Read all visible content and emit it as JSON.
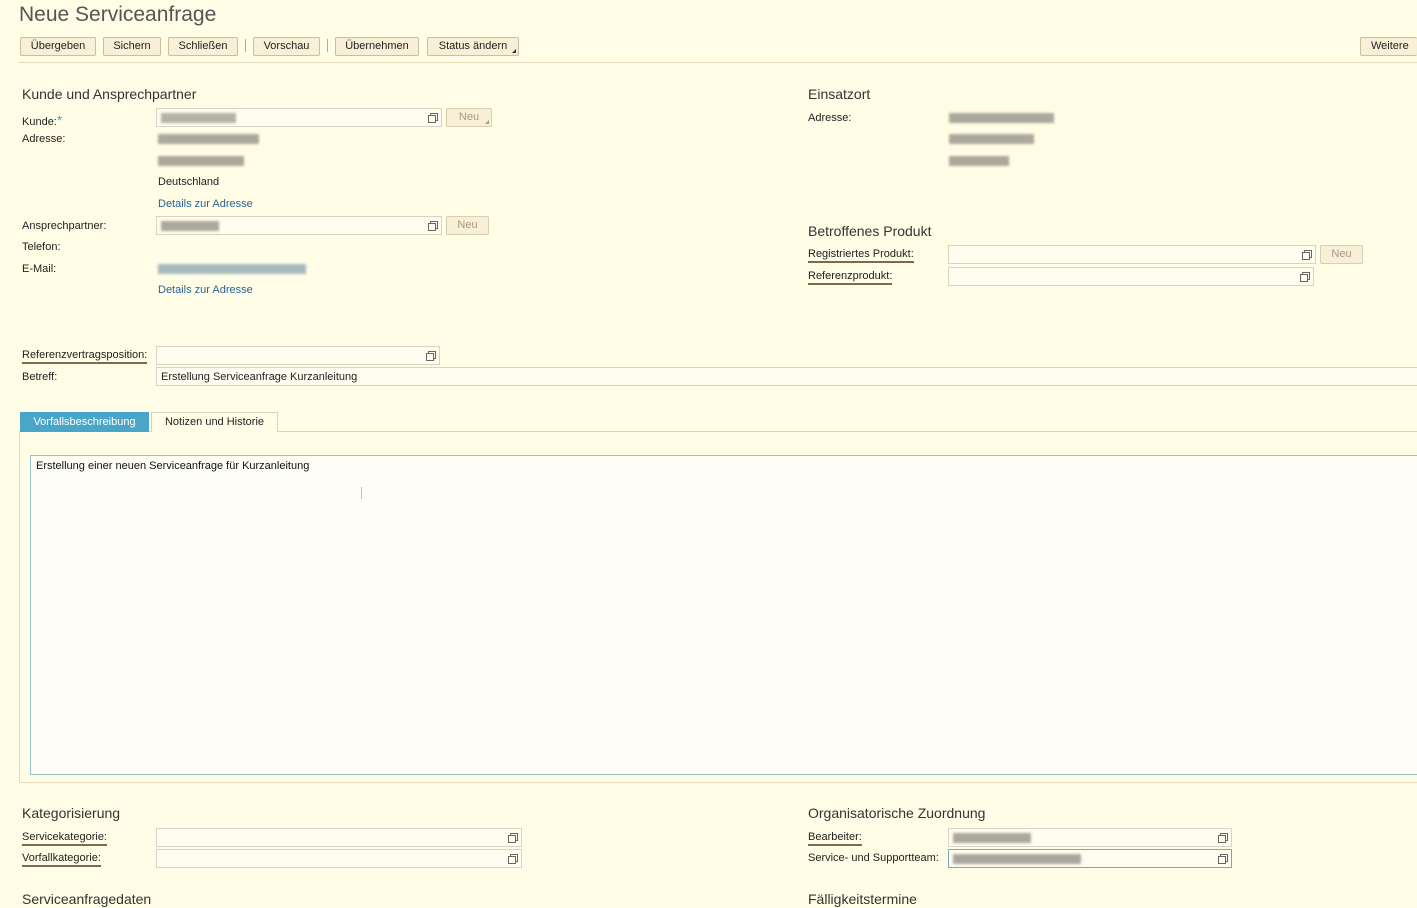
{
  "page": {
    "title": "Neue Serviceanfrage"
  },
  "toolbar": {
    "submit": "Übergeben",
    "save": "Sichern",
    "close": "Schließen",
    "preview": "Vorschau",
    "apply": "Übernehmen",
    "status": "Status ändern",
    "more": "Weitere M"
  },
  "customer": {
    "heading": "Kunde und Ansprechpartner",
    "kunde_label": "Kunde:",
    "required_mark": "*",
    "adresse_label": "Adresse:",
    "country": "Deutschland",
    "details_link": "Details zur Adresse",
    "ansprechpartner_label": "Ansprechpartner:",
    "telefon_label": "Telefon:",
    "email_label": "E-Mail:",
    "details_link2": "Details zur Adresse",
    "neu1": "Neu",
    "neu2": "Neu"
  },
  "einsatzort": {
    "heading": "Einsatzort",
    "adresse_label": "Adresse:"
  },
  "produkt": {
    "heading": "Betroffenes Produkt",
    "registriert_label": "Registriertes Produkt:",
    "referenz_label": "Referenzprodukt:",
    "neu": "Neu"
  },
  "general": {
    "refvertrag_label": "Referenzvertragsposition:",
    "betreff_label": "Betreff:",
    "betreff_value": "Erstellung Serviceanfrage Kurzanleitung"
  },
  "tabs": [
    {
      "label": "Vorfallsbeschreibung",
      "active": true
    },
    {
      "label": "Notizen und Historie",
      "active": false
    }
  ],
  "description": {
    "text": "Erstellung einer neuen Serviceanfrage für Kurzanleitung"
  },
  "kategorisierung": {
    "heading": "Kategorisierung",
    "servicekategorie_label": "Servicekategorie:",
    "vorfallkategorie_label": "Vorfallkategorie:"
  },
  "organisation": {
    "heading": "Organisatorische Zuordnung",
    "bearbeiter_label": "Bearbeiter:",
    "team_label": "Service- und Supportteam:"
  },
  "bottom": {
    "serviceanfragedaten": "Serviceanfragedaten",
    "faelligkeit": "Fälligkeitstermine"
  },
  "colors": {
    "background": "#fffde5",
    "tab_active": "#4aa6c8",
    "link": "#2a6496"
  }
}
